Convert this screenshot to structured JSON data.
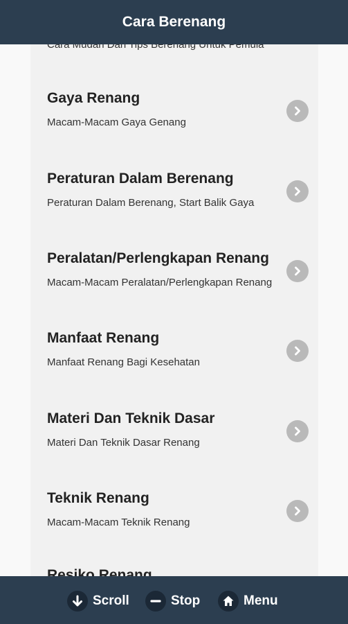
{
  "header": {
    "title": "Cara Berenang"
  },
  "list": {
    "partial_top_subtitle": "Cara Mudah Dan Tips Berenang Untuk Pemula",
    "items": [
      {
        "title": "Gaya Renang",
        "subtitle": "Macam-Macam Gaya Genang",
        "icon": "chevron-right-icon"
      },
      {
        "title": "Peraturan Dalam Berenang",
        "subtitle": "Peraturan Dalam Berenang, Start Balik Gaya",
        "icon": "chevron-right-icon"
      },
      {
        "title": "Peralatan/Perlengkapan Renang",
        "subtitle": "Macam-Macam Peralatan/Perlengkapan Renang",
        "icon": "chevron-right-icon"
      },
      {
        "title": "Manfaat Renang",
        "subtitle": "Manfaat Renang Bagi Kesehatan",
        "icon": "chevron-right-icon"
      },
      {
        "title": "Materi Dan Teknik Dasar",
        "subtitle": "Materi Dan Teknik Dasar Renang",
        "icon": "chevron-right-icon"
      },
      {
        "title": "Teknik Renang",
        "subtitle": "Macam-Macam Teknik Renang",
        "icon": "chevron-right-icon"
      }
    ],
    "partial_bottom_title": "Resiko Renang"
  },
  "bottom_bar": {
    "scroll_label": "Scroll",
    "stop_label": "Stop",
    "menu_label": "Menu"
  },
  "colors": {
    "bar": "#2c3e50",
    "panel": "#f1f1f1",
    "chevron": "#b9b9b9"
  }
}
